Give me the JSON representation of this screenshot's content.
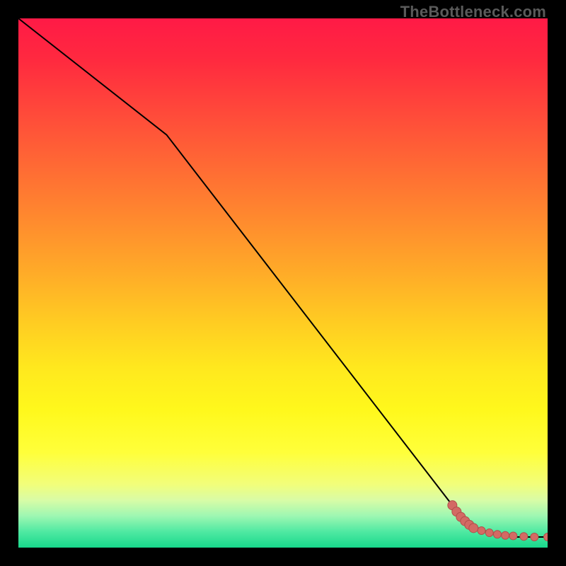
{
  "watermark": "TheBottleneck.com",
  "colors": {
    "curve": "#000000",
    "point_fill": "#d36a64",
    "point_stroke": "#b24f4a"
  },
  "chart_data": {
    "type": "line",
    "title": "",
    "xlabel": "",
    "ylabel": "",
    "xlim": [
      0,
      100
    ],
    "ylim": [
      0,
      100
    ],
    "series": [
      {
        "name": "curve",
        "x": [
          0,
          28,
          82,
          86,
          90,
          94,
          100
        ],
        "y": [
          100,
          78,
          8,
          4,
          2.5,
          2,
          2
        ]
      }
    ],
    "points": {
      "name": "data-points",
      "x": [
        82.0,
        82.8,
        83.6,
        84.4,
        85.2,
        86.0,
        87.5,
        89.0,
        90.5,
        92.0,
        93.5,
        95.5,
        97.5,
        100.0
      ],
      "y": [
        8.0,
        6.8,
        5.8,
        5.0,
        4.3,
        3.7,
        3.2,
        2.8,
        2.5,
        2.3,
        2.2,
        2.1,
        2.0,
        2.0
      ]
    }
  }
}
